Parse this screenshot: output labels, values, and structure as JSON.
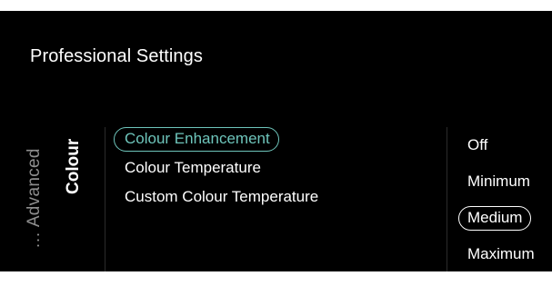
{
  "header": {
    "title": "Professional Settings"
  },
  "breadcrumb": {
    "parent": "… Advanced",
    "current": "Colour"
  },
  "menu": {
    "items": [
      {
        "label": "Colour Enhancement",
        "focused": true
      },
      {
        "label": "Colour Temperature",
        "focused": false
      },
      {
        "label": "Custom Colour Temperature",
        "focused": false
      }
    ]
  },
  "options": {
    "items": [
      {
        "label": "Off",
        "selected": false
      },
      {
        "label": "Minimum",
        "selected": false
      },
      {
        "label": "Medium",
        "selected": true
      },
      {
        "label": "Maximum",
        "selected": false
      }
    ]
  },
  "colors": {
    "background": "#000000",
    "focus_accent": "#6ec5bb",
    "text": "#ffffff",
    "muted_text": "#8e8e8e"
  }
}
